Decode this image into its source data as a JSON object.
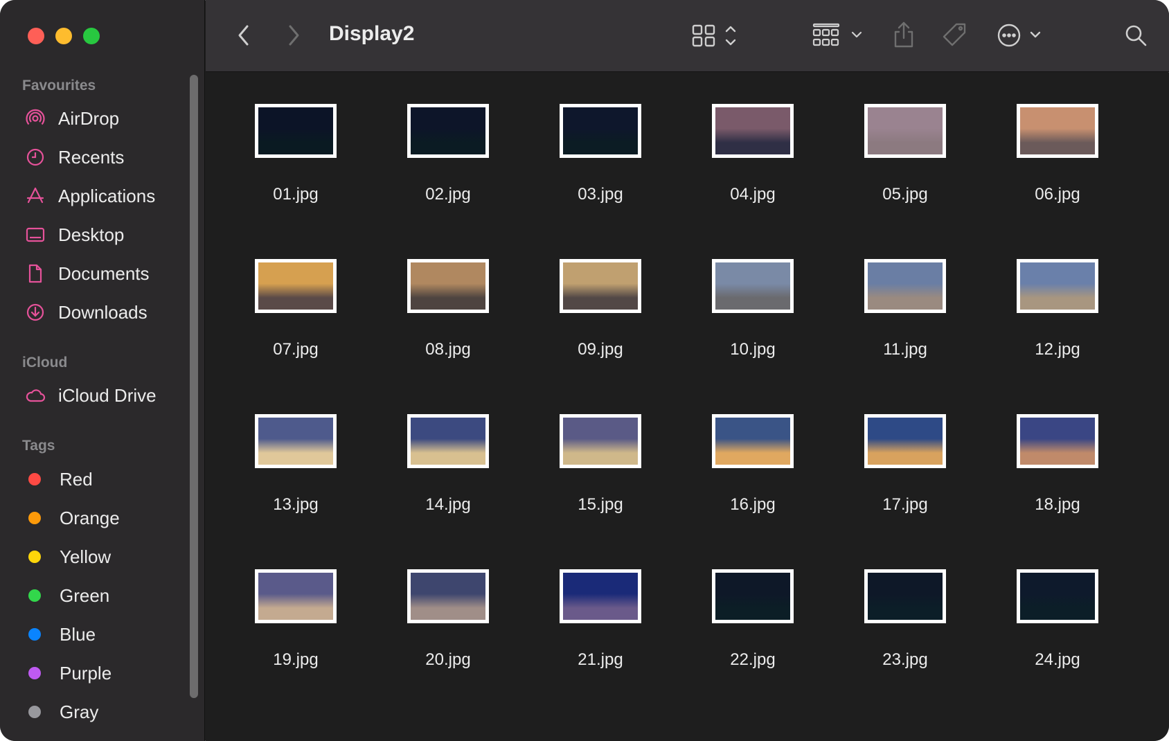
{
  "window": {
    "title": "Display2"
  },
  "sidebar": {
    "favourites_title": "Favourites",
    "favourites": [
      {
        "label": "AirDrop",
        "icon": "airdrop-icon"
      },
      {
        "label": "Recents",
        "icon": "clock-icon"
      },
      {
        "label": "Applications",
        "icon": "applications-icon"
      },
      {
        "label": "Desktop",
        "icon": "desktop-icon"
      },
      {
        "label": "Documents",
        "icon": "document-icon"
      },
      {
        "label": "Downloads",
        "icon": "download-icon"
      }
    ],
    "icloud_title": "iCloud",
    "icloud": [
      {
        "label": "iCloud Drive",
        "icon": "cloud-icon"
      }
    ],
    "tags_title": "Tags",
    "tags": [
      {
        "label": "Red",
        "color": "#fe4a44"
      },
      {
        "label": "Orange",
        "color": "#fd9a0a"
      },
      {
        "label": "Yellow",
        "color": "#fed60a"
      },
      {
        "label": "Green",
        "color": "#32d74b"
      },
      {
        "label": "Blue",
        "color": "#0a84ff"
      },
      {
        "label": "Purple",
        "color": "#bf5af2"
      },
      {
        "label": "Gray",
        "color": "#98989d"
      }
    ]
  },
  "toolbar": {
    "back": "chevron-left-icon",
    "forward": "chevron-right-icon",
    "view": "grid-view-icon",
    "group": "group-by-icon",
    "share": "share-icon",
    "tag": "tag-icon",
    "more": "ellipsis-circle-icon",
    "search": "search-icon"
  },
  "files": [
    {
      "name": "01.jpg",
      "sky": "#0c1427",
      "ground": "#0a1a22"
    },
    {
      "name": "02.jpg",
      "sky": "#0d1529",
      "ground": "#0b1b23"
    },
    {
      "name": "03.jpg",
      "sky": "#0e172c",
      "ground": "#0c1c24"
    },
    {
      "name": "04.jpg",
      "sky": "#7a5a6a",
      "ground": "#2f2f45"
    },
    {
      "name": "05.jpg",
      "sky": "#9a8390",
      "ground": "#8c7a80"
    },
    {
      "name": "06.jpg",
      "sky": "#c89070",
      "ground": "#6b5a5a"
    },
    {
      "name": "07.jpg",
      "sky": "#d6a050",
      "ground": "#5a4a48"
    },
    {
      "name": "08.jpg",
      "sky": "#b08860",
      "ground": "#4e4440"
    },
    {
      "name": "09.jpg",
      "sky": "#c0a070",
      "ground": "#524846"
    },
    {
      "name": "10.jpg",
      "sky": "#7a8aa6",
      "ground": "#6a6a6e"
    },
    {
      "name": "11.jpg",
      "sky": "#6a7ea4",
      "ground": "#9a8a80"
    },
    {
      "name": "12.jpg",
      "sky": "#6a80aa",
      "ground": "#a89680"
    },
    {
      "name": "13.jpg",
      "sky": "#4e5a8c",
      "ground": "#e0c89a"
    },
    {
      "name": "14.jpg",
      "sky": "#3c4a80",
      "ground": "#d8c090"
    },
    {
      "name": "15.jpg",
      "sky": "#5a5a86",
      "ground": "#cfb88a"
    },
    {
      "name": "16.jpg",
      "sky": "#3a5486",
      "ground": "#e0a860"
    },
    {
      "name": "17.jpg",
      "sky": "#2e4a86",
      "ground": "#d8a25e"
    },
    {
      "name": "18.jpg",
      "sky": "#3a4684",
      "ground": "#c08a6a"
    },
    {
      "name": "19.jpg",
      "sky": "#5a5a8a",
      "ground": "#c4aa90"
    },
    {
      "name": "20.jpg",
      "sky": "#3e466e",
      "ground": "#a08e88"
    },
    {
      "name": "21.jpg",
      "sky": "#1a2a78",
      "ground": "#6a5a8a"
    },
    {
      "name": "22.jpg",
      "sky": "#0e1828",
      "ground": "#0c1e26"
    },
    {
      "name": "23.jpg",
      "sky": "#0e1828",
      "ground": "#0c1e28"
    },
    {
      "name": "24.jpg",
      "sky": "#0e1a2c",
      "ground": "#0c1e28"
    }
  ]
}
